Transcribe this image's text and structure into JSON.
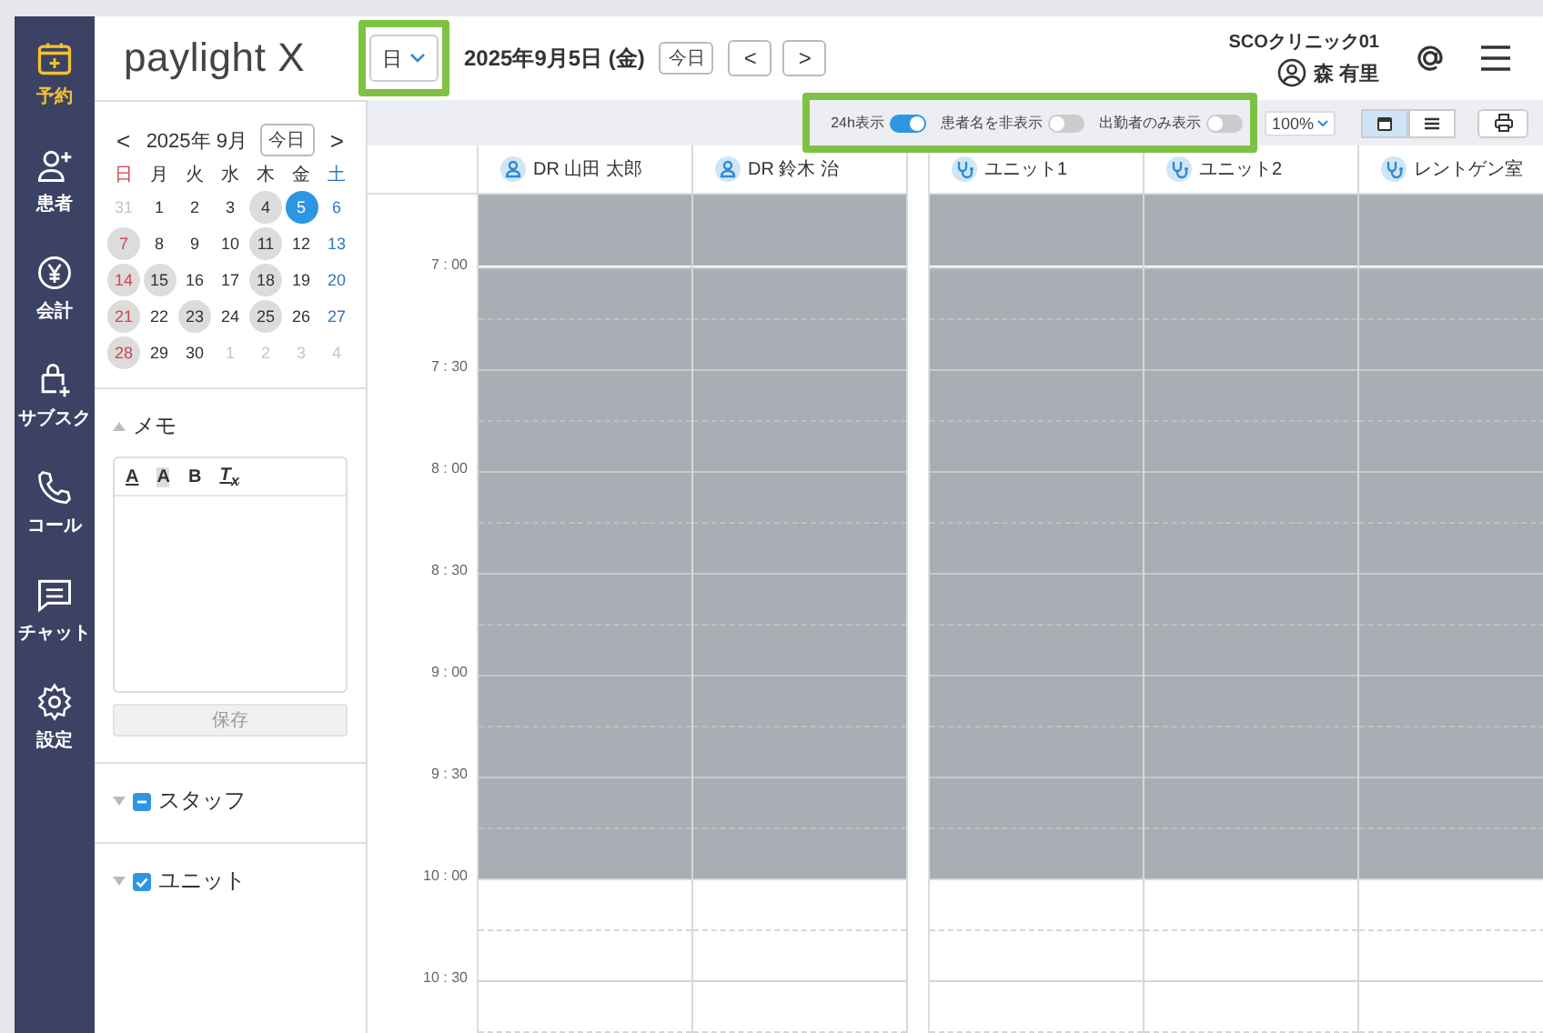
{
  "nav": [
    {
      "label": "予約",
      "selected": true
    },
    {
      "label": "患者",
      "selected": false
    },
    {
      "label": "会計",
      "selected": false
    },
    {
      "label": "サブスク",
      "selected": false
    },
    {
      "label": "コール",
      "selected": false
    },
    {
      "label": "チャット",
      "selected": false
    },
    {
      "label": "設定",
      "selected": false
    }
  ],
  "header": {
    "logo": "paylight X",
    "view": "日",
    "date": "2025年9月5日 (金)",
    "today": "今日",
    "prev": "<",
    "next": ">",
    "clinic": "SCOクリニック01",
    "user": "森 有里"
  },
  "mini_calendar": {
    "prev": "<",
    "title": "2025年 9月",
    "today": "今日",
    "next": ">",
    "weekdays": [
      "日",
      "月",
      "火",
      "水",
      "木",
      "金",
      "土"
    ],
    "weeks": [
      [
        {
          "day": "31",
          "outside": true,
          "marked": false,
          "selected": false
        },
        {
          "day": "1",
          "outside": false,
          "marked": false,
          "selected": false
        },
        {
          "day": "2",
          "outside": false,
          "marked": false,
          "selected": false
        },
        {
          "day": "3",
          "outside": false,
          "marked": false,
          "selected": false
        },
        {
          "day": "4",
          "outside": false,
          "marked": true,
          "selected": false
        },
        {
          "day": "5",
          "outside": false,
          "marked": false,
          "selected": true
        },
        {
          "day": "6",
          "outside": false,
          "marked": false,
          "selected": false
        }
      ],
      [
        {
          "day": "7",
          "outside": false,
          "marked": true,
          "selected": false
        },
        {
          "day": "8",
          "outside": false,
          "marked": false,
          "selected": false
        },
        {
          "day": "9",
          "outside": false,
          "marked": false,
          "selected": false
        },
        {
          "day": "10",
          "outside": false,
          "marked": false,
          "selected": false
        },
        {
          "day": "11",
          "outside": false,
          "marked": true,
          "selected": false
        },
        {
          "day": "12",
          "outside": false,
          "marked": false,
          "selected": false
        },
        {
          "day": "13",
          "outside": false,
          "marked": false,
          "selected": false
        }
      ],
      [
        {
          "day": "14",
          "outside": false,
          "marked": true,
          "selected": false
        },
        {
          "day": "15",
          "outside": false,
          "marked": true,
          "selected": false
        },
        {
          "day": "16",
          "outside": false,
          "marked": false,
          "selected": false
        },
        {
          "day": "17",
          "outside": false,
          "marked": false,
          "selected": false
        },
        {
          "day": "18",
          "outside": false,
          "marked": true,
          "selected": false
        },
        {
          "day": "19",
          "outside": false,
          "marked": false,
          "selected": false
        },
        {
          "day": "20",
          "outside": false,
          "marked": false,
          "selected": false
        }
      ],
      [
        {
          "day": "21",
          "outside": false,
          "marked": true,
          "selected": false
        },
        {
          "day": "22",
          "outside": false,
          "marked": false,
          "selected": false
        },
        {
          "day": "23",
          "outside": false,
          "marked": true,
          "selected": false
        },
        {
          "day": "24",
          "outside": false,
          "marked": false,
          "selected": false
        },
        {
          "day": "25",
          "outside": false,
          "marked": true,
          "selected": false
        },
        {
          "day": "26",
          "outside": false,
          "marked": false,
          "selected": false
        },
        {
          "day": "27",
          "outside": false,
          "marked": false,
          "selected": false
        }
      ],
      [
        {
          "day": "28",
          "outside": false,
          "marked": true,
          "selected": false
        },
        {
          "day": "29",
          "outside": false,
          "marked": false,
          "selected": false
        },
        {
          "day": "30",
          "outside": false,
          "marked": false,
          "selected": false
        },
        {
          "day": "1",
          "outside": true,
          "marked": false,
          "selected": false
        },
        {
          "day": "2",
          "outside": true,
          "marked": false,
          "selected": false
        },
        {
          "day": "3",
          "outside": true,
          "marked": false,
          "selected": false
        },
        {
          "day": "4",
          "outside": true,
          "marked": false,
          "selected": false
        }
      ]
    ]
  },
  "memo": {
    "title": "メモ",
    "expanded": true,
    "tools": [
      {
        "label": "A",
        "kind": "color"
      },
      {
        "label": "A",
        "kind": "highlight"
      },
      {
        "label": "B",
        "kind": "bold"
      },
      {
        "label": "T$_{x}$",
        "kind": "clear"
      }
    ],
    "save": "保存",
    "save_disabled": true
  },
  "groups": [
    {
      "label": "スタッフ",
      "expanded": false,
      "checked": false,
      "indeterminate": true
    },
    {
      "label": "ユニット",
      "expanded": false,
      "checked": true,
      "indeterminate": false
    }
  ],
  "toolbar": {
    "toggles": [
      {
        "label": "24h表示",
        "on": true
      },
      {
        "label": "患者名を非表示",
        "on": false
      },
      {
        "label": "出勤者のみ表示",
        "on": false
      }
    ],
    "zoom": "100%",
    "views": [
      {
        "selected": true
      },
      {
        "selected": false
      }
    ]
  },
  "columns": [
    {
      "label": "DR 山田 太郎",
      "kind": "staff"
    },
    {
      "label": "DR 鈴木 治",
      "kind": "staff"
    },
    {
      "label": "ユニット1",
      "kind": "unit"
    },
    {
      "label": "ユニット2",
      "kind": "unit"
    },
    {
      "label": "レントゲン室",
      "kind": "unit"
    }
  ],
  "slots": [
    {
      "time": "7 : 00",
      "unavailable": true
    },
    {
      "time": "7 : 30",
      "unavailable": true
    },
    {
      "time": "8 : 00",
      "unavailable": true
    },
    {
      "time": "8 : 30",
      "unavailable": true
    },
    {
      "time": "9 : 00",
      "unavailable": true
    },
    {
      "time": "9 : 30",
      "unavailable": true
    },
    {
      "time": "10 : 00",
      "unavailable": false
    },
    {
      "time": "10 : 30",
      "unavailable": false
    }
  ]
}
